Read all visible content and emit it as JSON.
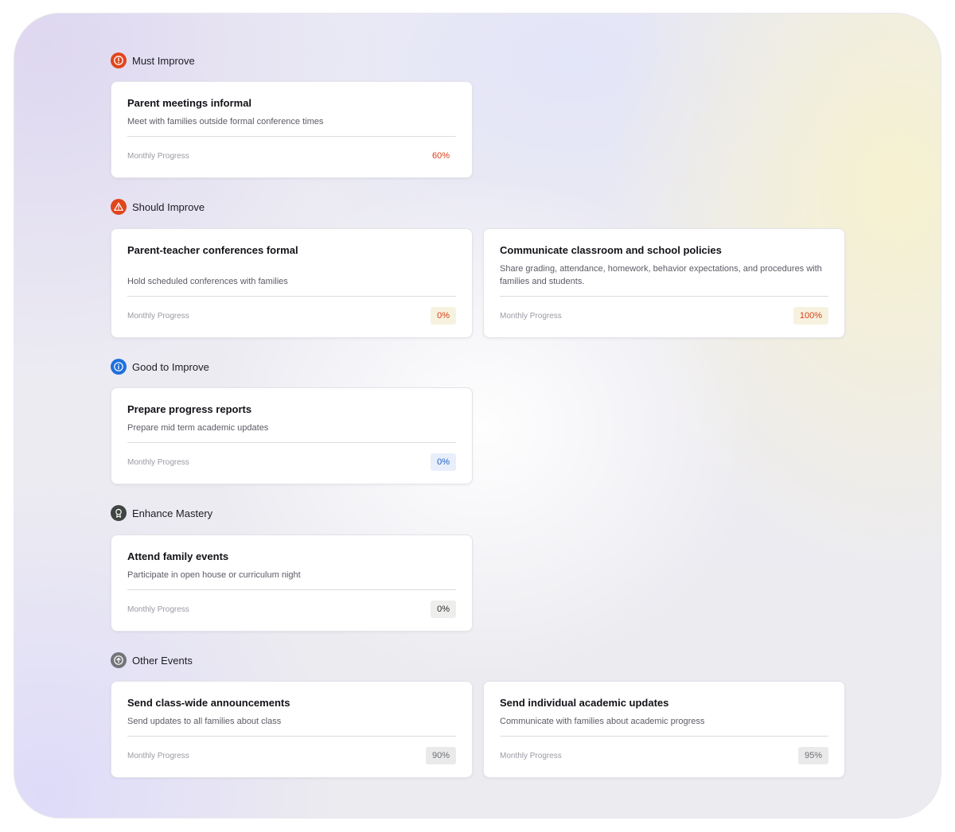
{
  "colors": {
    "must": "#e0461c",
    "should": "#e0461c",
    "good": "#1f6fdb",
    "mastery": "#3f4540",
    "other": "#73757a"
  },
  "sections": {
    "must": {
      "title": "Must Improve",
      "icon": "alert-circle-icon",
      "cards": [
        {
          "title": "Parent meetings informal",
          "description": "Meet with families outside formal conference times",
          "progress_label": "Monthly Progress",
          "progress": "60%"
        }
      ]
    },
    "should": {
      "title": "Should Improve",
      "icon": "warning-triangle-icon",
      "cards": [
        {
          "title": "Parent-teacher conferences formal",
          "description": "Hold scheduled conferences with families",
          "progress_label": "Monthly Progress",
          "progress": "0%"
        },
        {
          "title": "Communicate classroom and school policies",
          "description": "Share grading, attendance, homework, behavior expectations, and procedures with families and students.",
          "progress_label": "Monthly Progress",
          "progress": "100%"
        }
      ]
    },
    "good": {
      "title": "Good to Improve",
      "icon": "info-icon",
      "cards": [
        {
          "title": "Prepare progress reports",
          "description": "Prepare mid term academic updates",
          "progress_label": "Monthly Progress",
          "progress": "0%"
        }
      ]
    },
    "mastery": {
      "title": "Enhance Mastery",
      "icon": "award-icon",
      "cards": [
        {
          "title": "Attend family events",
          "description": "Participate in open house or curriculum night",
          "progress_label": "Monthly Progress",
          "progress": "0%"
        }
      ]
    },
    "other": {
      "title": "Other Events",
      "icon": "arrow-up-circle-icon",
      "cards": [
        {
          "title": "Send class-wide announcements",
          "description": "Send updates to all families about class",
          "progress_label": "Monthly Progress",
          "progress": "90%"
        },
        {
          "title": "Send individual academic updates",
          "description": "Communicate with families about academic progress",
          "progress_label": "Monthly Progress",
          "progress": "95%"
        }
      ]
    }
  }
}
